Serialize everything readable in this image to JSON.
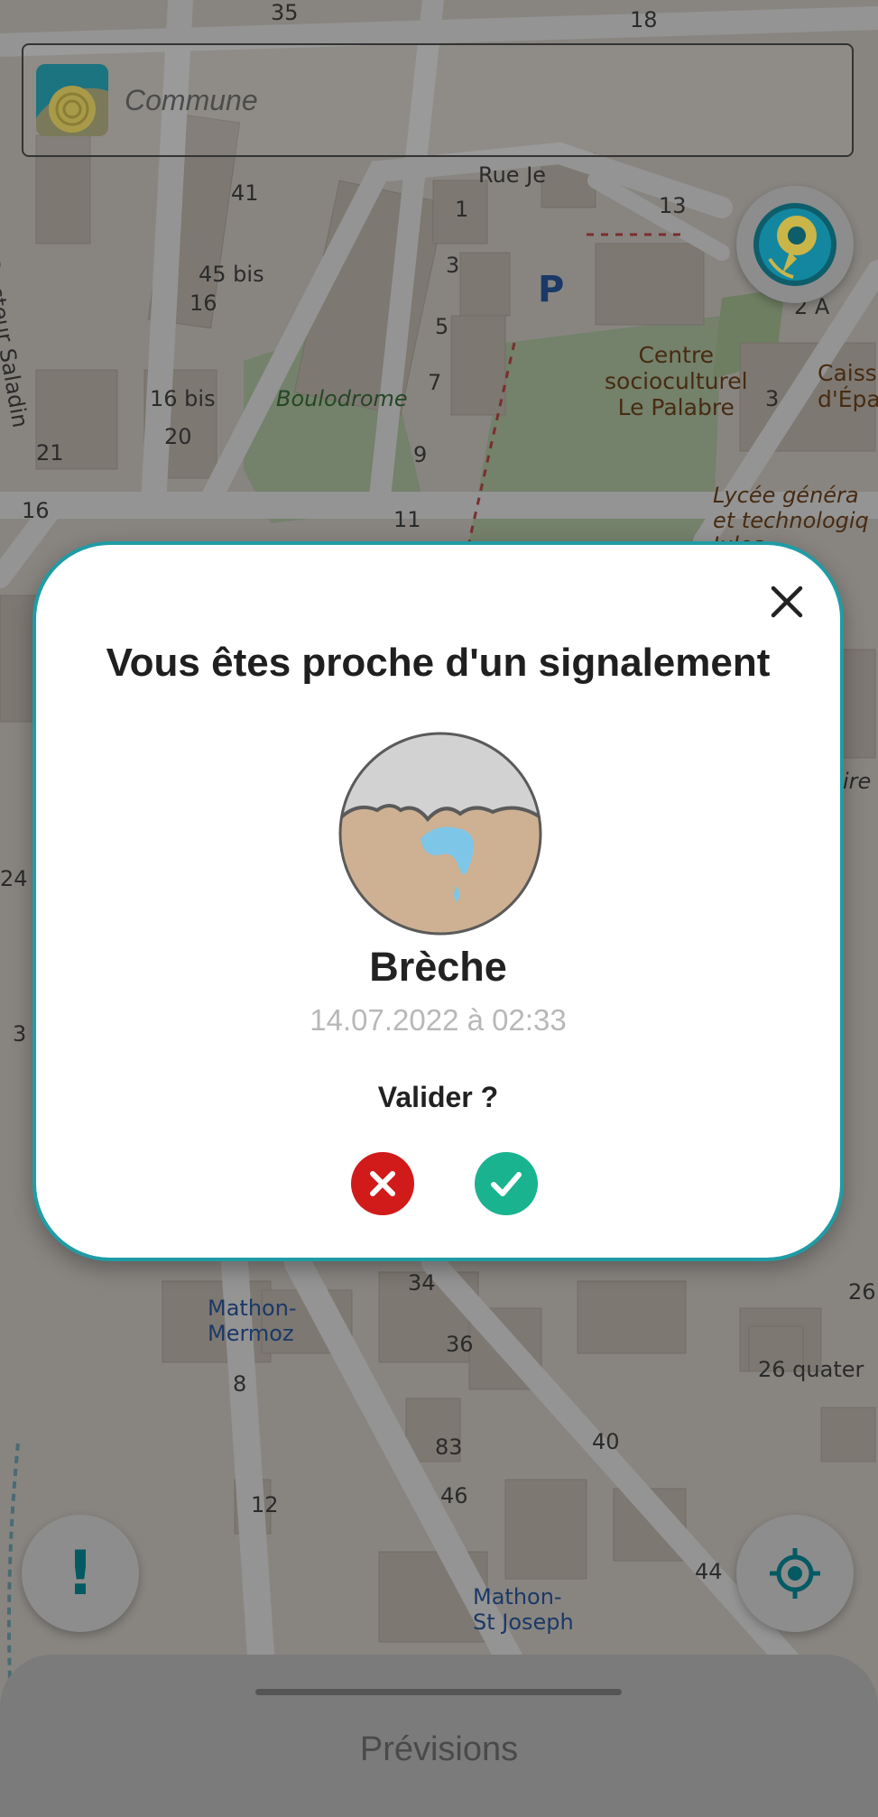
{
  "map": {
    "street_labels": [
      "Rue Je",
      "Rue Docteur Saladin",
      "Boulodrome"
    ],
    "house_numbers": [
      "35",
      "18",
      "41",
      "45 bis",
      "16",
      "16 bis",
      "20",
      "21",
      "16",
      "1",
      "3",
      "5",
      "7",
      "9",
      "11",
      "13",
      "3",
      "2 A",
      "24",
      "3",
      "34",
      "36",
      "40",
      "26",
      "26 quater",
      "8",
      "83",
      "46",
      "12",
      "44"
    ],
    "poi": {
      "centre": "Centre\nsocioculturel\nLe Palabre",
      "caisse": "Caiss\nd'Éparg",
      "lycee": "Lycée généra\net technologiq\nJules\nnt",
      "parking": "P",
      "partial_right": "ire"
    },
    "bus_stops": [
      "Mathon-\nMermoz",
      "Mathon-\nSt Joseph"
    ]
  },
  "search": {
    "placeholder": "Commune"
  },
  "modal": {
    "title": "Vous êtes proche d'un signalement",
    "incident_name": "Brèche",
    "incident_date": "14.07.2022 à 02:33",
    "confirm_question": "Valider ?",
    "icon": "breach-icon",
    "close_icon": "close-icon",
    "reject_icon": "reject-icon",
    "accept_icon": "accept-icon"
  },
  "fabs": {
    "top": "location-pin-icon",
    "alert": "!",
    "locate": "crosshair-icon"
  },
  "bottom_sheet": {
    "label": "Prévisions"
  },
  "colors": {
    "accent": "#1f9ca5",
    "reject": "#d11a1a",
    "accept": "#19b38f"
  }
}
